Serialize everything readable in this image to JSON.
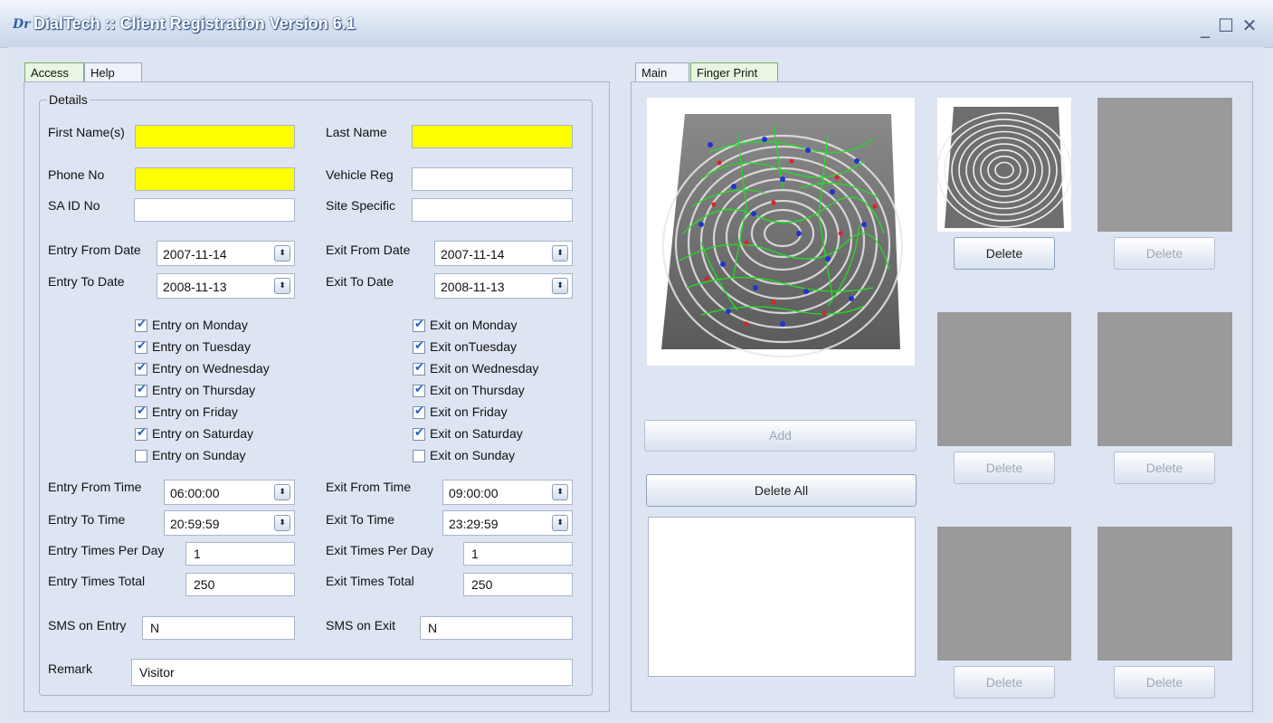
{
  "window": {
    "title": "DialTech :: Client Registration Version 6.1",
    "icon_glyph": "Dr",
    "minimize": "_",
    "maximize": "☐",
    "close": "✕"
  },
  "left_tabs": [
    "Access",
    "Help"
  ],
  "right_tabs": [
    "Main",
    "Finger Print"
  ],
  "details": {
    "group_title": "Details",
    "first_name_label": "First Name(s)",
    "first_name_value": "",
    "last_name_label": "Last Name",
    "last_name_value": "",
    "phone_label": "Phone No",
    "phone_value": "",
    "vehicle_label": "Vehicle Reg",
    "vehicle_value": "",
    "said_label": "SA ID No",
    "said_value": "",
    "site_label": "Site Specific",
    "site_value": "",
    "entry_from_date_label": "Entry From Date",
    "entry_from_date": "2007-11-14",
    "exit_from_date_label": "Exit From Date",
    "exit_from_date": "2007-11-14",
    "entry_to_date_label": "Entry To Date",
    "entry_to_date": "2008-11-13",
    "exit_to_date_label": "Exit To Date",
    "exit_to_date": "2008-11-13",
    "entry_days": [
      {
        "label": "Entry on Monday",
        "checked": true
      },
      {
        "label": "Entry on Tuesday",
        "checked": true
      },
      {
        "label": "Entry on Wednesday",
        "checked": true
      },
      {
        "label": "Entry on Thursday",
        "checked": true
      },
      {
        "label": "Entry on Friday",
        "checked": true
      },
      {
        "label": "Entry on Saturday",
        "checked": true
      },
      {
        "label": "Entry on Sunday",
        "checked": false
      }
    ],
    "exit_days": [
      {
        "label": "Exit on Monday",
        "checked": true
      },
      {
        "label": "Exit onTuesday",
        "checked": true
      },
      {
        "label": "Exit on Wednesday",
        "checked": true
      },
      {
        "label": "Exit on Thursday",
        "checked": true
      },
      {
        "label": "Exit on Friday",
        "checked": true
      },
      {
        "label": "Exit on Saturday",
        "checked": true
      },
      {
        "label": "Exit on Sunday",
        "checked": false
      }
    ],
    "entry_from_time_label": "Entry From Time",
    "entry_from_time": "06:00:00",
    "exit_from_time_label": "Exit From Time",
    "exit_from_time": "09:00:00",
    "entry_to_time_label": "Entry To Time",
    "entry_to_time": "20:59:59",
    "exit_to_time_label": "Exit To Time",
    "exit_to_time": "23:29:59",
    "entry_per_day_label": "Entry Times Per Day",
    "entry_per_day": "1",
    "exit_per_day_label": "Exit Times Per Day",
    "exit_per_day": "1",
    "entry_total_label": "Entry Times Total",
    "entry_total": "250",
    "exit_total_label": "Exit Times Total",
    "exit_total": "250",
    "sms_entry_label": "SMS on Entry",
    "sms_entry": "N",
    "sms_exit_label": "SMS on Exit",
    "sms_exit": "N",
    "remark_label": "Remark",
    "remark": "Visitor"
  },
  "fingerprint": {
    "add_label": "Add",
    "delete_all_label": "Delete All",
    "delete_label": "Delete",
    "slot_count": 6
  },
  "colors": {
    "required_field": "#ffff00",
    "slot_empty": "#9a9a9a",
    "minutiae_ridge": "#22dd22",
    "minutiae_point": "#2233cc"
  }
}
